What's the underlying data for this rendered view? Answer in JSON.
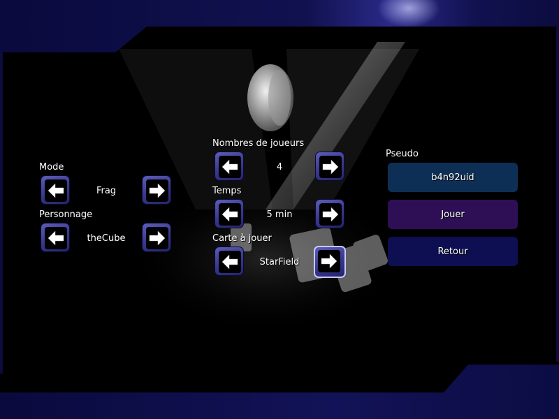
{
  "settings": {
    "mode": {
      "label": "Mode",
      "value": "Frag"
    },
    "character": {
      "label": "Personnage",
      "value": "theCube"
    },
    "players": {
      "label": "Nombres de joueurs",
      "value": "4"
    },
    "time": {
      "label": "Temps",
      "value": "5 min"
    },
    "map": {
      "label": "Carte à jouer",
      "value": "StarField"
    }
  },
  "pseudo": {
    "label": "Pseudo",
    "value": "b4n92uid"
  },
  "buttons": {
    "play": "Jouer",
    "back": "Retour"
  },
  "icons": {
    "prev": "arrow-left-icon",
    "next": "arrow-right-icon"
  },
  "colors": {
    "pseudo_bg": "#0e2f55",
    "play_bg": "#2e0f55",
    "back_bg": "#0d0f52",
    "arrow_button": "#3a3a90"
  }
}
